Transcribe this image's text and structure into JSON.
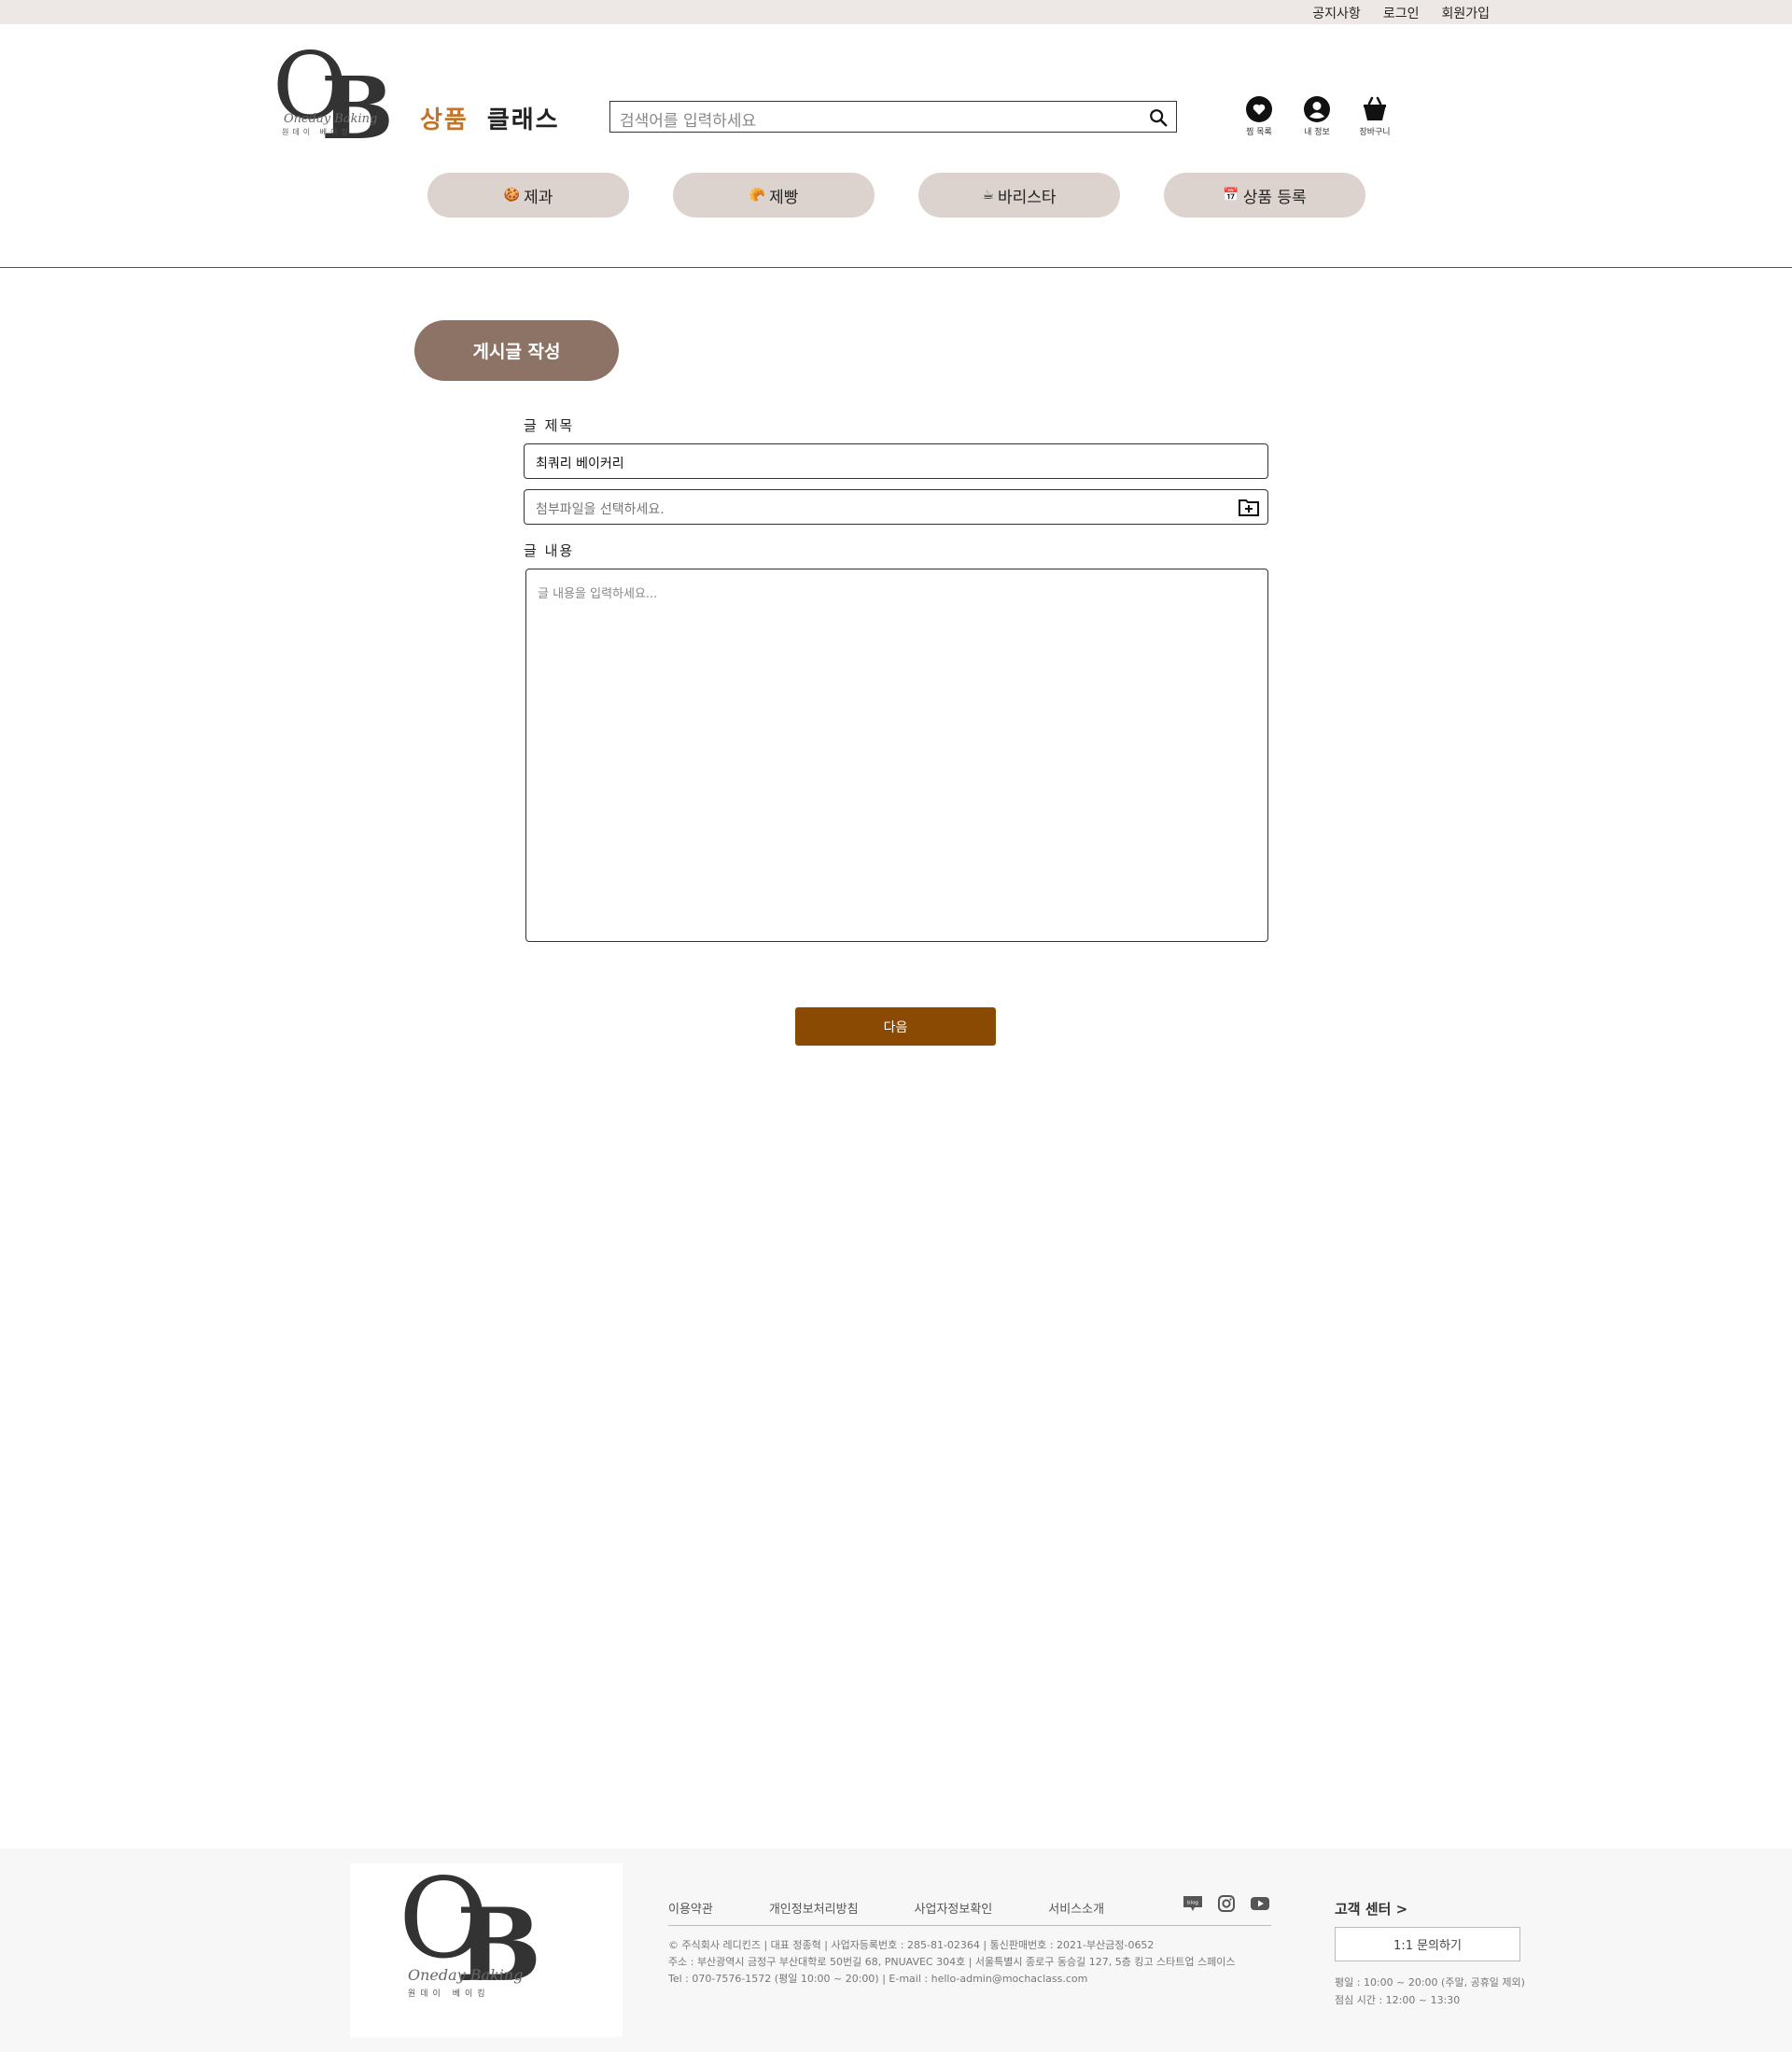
{
  "topbar": {
    "notice": "공지사항",
    "login": "로그인",
    "signup": "회원가입"
  },
  "logo": {
    "letters_o": "O",
    "letters_b": "B",
    "script": "Oneday Baking",
    "korean": "원데이 베이킹"
  },
  "header": {
    "cat_product": "상품",
    "cat_class": "클래스",
    "search_placeholder": "검색어를 입력하세요",
    "wishlist": "찜 목록",
    "myinfo": "내 정보",
    "cart": "장바구니"
  },
  "pills": [
    {
      "emoji": "🍪",
      "label": "제과"
    },
    {
      "emoji": "🥐",
      "label": "제빵"
    },
    {
      "emoji": "☕",
      "label": "바리스타"
    },
    {
      "emoji": "📅",
      "label": "상품 등록"
    }
  ],
  "page": {
    "badge": "게시글 작성"
  },
  "form": {
    "title_label": "글 제목",
    "title_value": "최쿼리 베이커리",
    "file_placeholder": "첨부파일을 선택하세요.",
    "content_label": "글 내용",
    "content_placeholder": "글 내용을 입력하세요...",
    "next_button": "다음"
  },
  "footer": {
    "links": [
      "이용약관",
      "개인정보처리방침",
      "사업자정보확인",
      "서비스소개"
    ],
    "social": [
      "blog-icon",
      "instagram-icon",
      "youtube-icon"
    ],
    "blog_label": "blog",
    "info_line1": "© 주식회사 레디킨즈 | 대표 정종혁 | 사업자등록번호 : 285-81-02364 | 통신판매번호 : 2021-부산금정-0652",
    "info_line2": "주소 : 부산광역시 금정구 부산대학로 50번길 68, PNUAVEC 304호 | 서울특별시 종로구 동승길 127, 5층 킹고 스타트업 스페이스",
    "info_line3": "Tel : 070-7576-1572 (평일 10:00 ~ 20:00) | E-mail : hello-admin@mochaclass.com",
    "cs_title": "고객 센터 >",
    "cs_button": "1:1 문의하기",
    "cs_hours1": "평일 : 10:00 ~ 20:00 (주말, 공휴일 제외)",
    "cs_hours2": "점심 시간 : 12:00 ~ 13:30"
  },
  "colors": {
    "accent": "#c2752a",
    "next_button": "#8b4a03",
    "badge": "#8d7366",
    "pill": "#ddd3ce",
    "topbar": "#ede8e6"
  }
}
